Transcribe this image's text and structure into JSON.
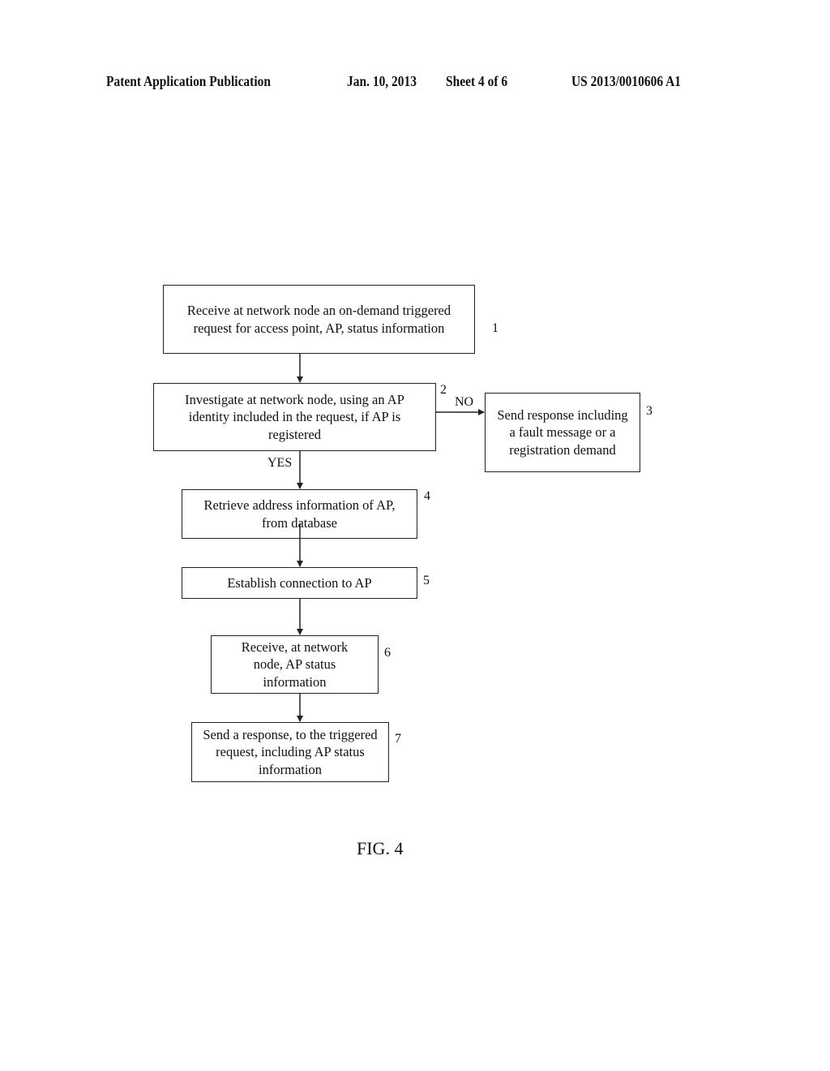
{
  "header": {
    "left": "Patent Application Publication",
    "date": "Jan. 10, 2013",
    "sheet": "Sheet 4 of 6",
    "number": "US 2013/0010606 A1"
  },
  "flowchart": {
    "steps": [
      {
        "id": "1",
        "text": "Receive at network node an on-demand triggered request for access point, AP, status information"
      },
      {
        "id": "2",
        "text": "Investigate at network node, using an AP identity included in the request, if AP is registered"
      },
      {
        "id": "3",
        "text": "Send response including a fault message or a registration demand"
      },
      {
        "id": "4",
        "text": "Retrieve address information of AP, from database"
      },
      {
        "id": "5",
        "text": "Establish connection to AP"
      },
      {
        "id": "6",
        "text": "Receive, at network node, AP status information"
      },
      {
        "id": "7",
        "text": "Send a response, to the triggered request, including AP status information"
      }
    ],
    "branch_labels": {
      "no": "NO",
      "yes": "YES"
    }
  },
  "figure_label": "FIG. 4"
}
